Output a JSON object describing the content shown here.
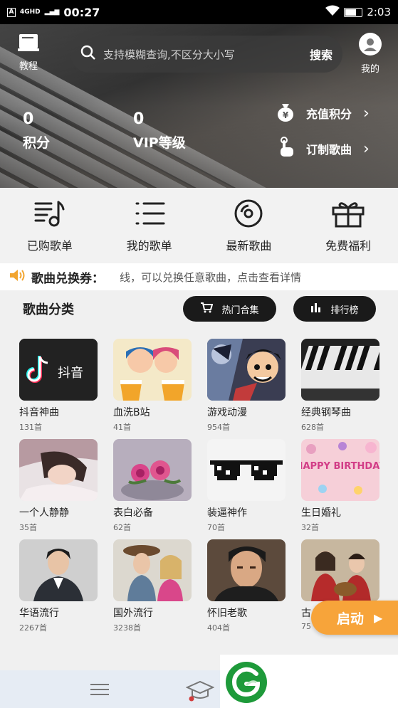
{
  "status_bar": {
    "carrier_badge": "A",
    "network": "4GHD",
    "time": "00:27",
    "right_time": "2:03"
  },
  "header": {
    "tutorial_label": "教程",
    "search_placeholder": "支持模糊查询,不区分大小写",
    "search_button": "搜索",
    "profile_label": "我的"
  },
  "stats": {
    "points_value": "0",
    "points_label": "积分",
    "vip_value": "0",
    "vip_label": "VIP等级"
  },
  "hero_links": {
    "recharge": "充值积分",
    "order_song": "订制歌曲"
  },
  "quick_menu": [
    {
      "label": "已购歌单",
      "icon": "purchased-list-icon"
    },
    {
      "label": "我的歌单",
      "icon": "my-list-icon"
    },
    {
      "label": "最新歌曲",
      "icon": "disc-icon"
    },
    {
      "label": "免费福利",
      "icon": "gift-icon"
    }
  ],
  "ticker": {
    "title": "歌曲兑换券：",
    "message": "线，可以兑换任意歌曲，点击查看详情"
  },
  "categories_section": {
    "title": "歌曲分类",
    "hot_button": "热门合集",
    "rank_button": "排行榜"
  },
  "categories": [
    {
      "name": "抖音神曲",
      "count": "131首",
      "thumb_text": "抖音"
    },
    {
      "name": "血洗B站",
      "count": "41首"
    },
    {
      "name": "游戏动漫",
      "count": "954首"
    },
    {
      "name": "经典钢琴曲",
      "count": "628首"
    },
    {
      "name": "一个人静静",
      "count": "35首"
    },
    {
      "name": "表白必备",
      "count": "62首"
    },
    {
      "name": "装逼神作",
      "count": "70首"
    },
    {
      "name": "生日婚礼",
      "count": "32首",
      "thumb_text": "HAPPY BIRTHDAY"
    },
    {
      "name": "华语流行",
      "count": "2267首"
    },
    {
      "name": "国外流行",
      "count": "3238首"
    },
    {
      "name": "怀旧老歌",
      "count": "404首"
    },
    {
      "name": "古",
      "count": "75"
    }
  ],
  "start_button": "启动",
  "colors": {
    "accent_orange": "#f7a43a",
    "pill_dark": "#1a1a1a",
    "logo_green": "#1e9a3a"
  }
}
